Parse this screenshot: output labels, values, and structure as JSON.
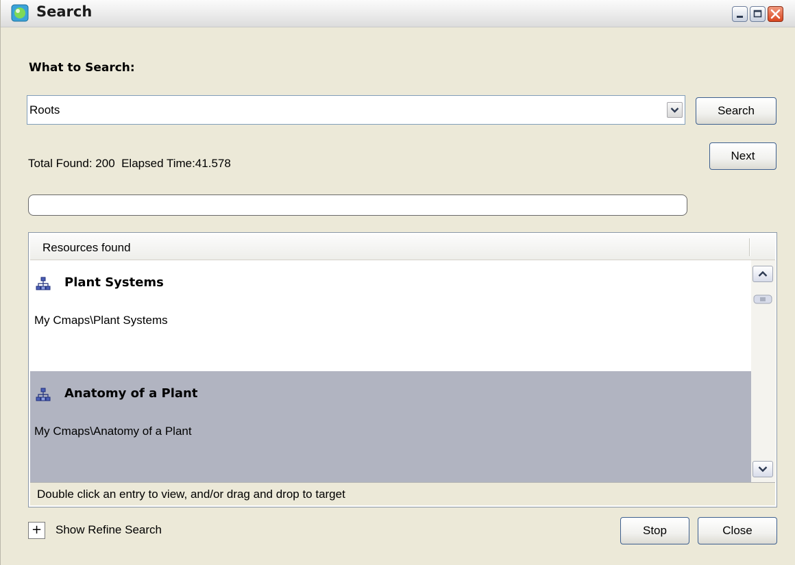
{
  "window": {
    "title": "Search",
    "controls": [
      "minimize",
      "maximize",
      "close"
    ]
  },
  "search": {
    "label": "What to Search:",
    "query": "Roots",
    "search_button": "Search",
    "next_button": "Next"
  },
  "status": {
    "text": "Total Found: 200  Elapsed Time:41.578"
  },
  "progress": {
    "value": 0
  },
  "results": {
    "header": "Resources found",
    "items": [
      {
        "title": "Plant Systems",
        "path": "My Cmaps\\Plant Systems",
        "icon": "cmap-icon",
        "selected": false
      },
      {
        "title": "Anatomy of a Plant",
        "path": "My Cmaps\\Anatomy of a Plant",
        "icon": "cmap-icon",
        "selected": true
      }
    ],
    "hint": "Double click an entry to view, and/or drag and drop to target"
  },
  "footer": {
    "refine_toggle": "+",
    "refine_label": "Show Refine Search",
    "stop_button": "Stop",
    "close_button": "Close"
  },
  "colors": {
    "selected_row": "#b1b4c1",
    "window_bg": "#ece9d8",
    "button_border": "#3c5e8e"
  }
}
